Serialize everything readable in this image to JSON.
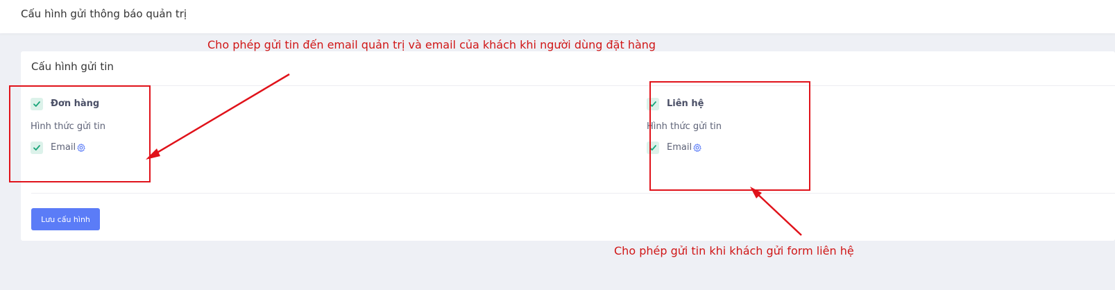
{
  "page": {
    "title": "Cấu hình gửi thông báo quản trị"
  },
  "card": {
    "title": "Cấu hình gửi tin",
    "order": {
      "label": "Đơn hàng",
      "checked": true,
      "method_label": "Hình thức gửi tin",
      "channel": {
        "label": "Email",
        "checked": true,
        "icon": "gear-icon"
      }
    },
    "contact": {
      "label": "Liên hệ",
      "checked": true,
      "method_label": "Hình thức gửi tin",
      "channel": {
        "label": "Email",
        "checked": true,
        "icon": "gear-icon"
      }
    },
    "save_label": "Lưu cấu hình"
  },
  "annotations": {
    "order_note": "Cho phép gửi tin đến email quản trị và email của khách khi người dùng đặt hàng",
    "contact_note": "Cho phép gửi tin khi khách gửi form liên hệ",
    "color": "#e0121a"
  },
  "colors": {
    "accent": "#5b7cf7",
    "check_bg": "#dcf2ea",
    "check_mark": "#1aa57a",
    "gear": "#5b7cf7"
  }
}
